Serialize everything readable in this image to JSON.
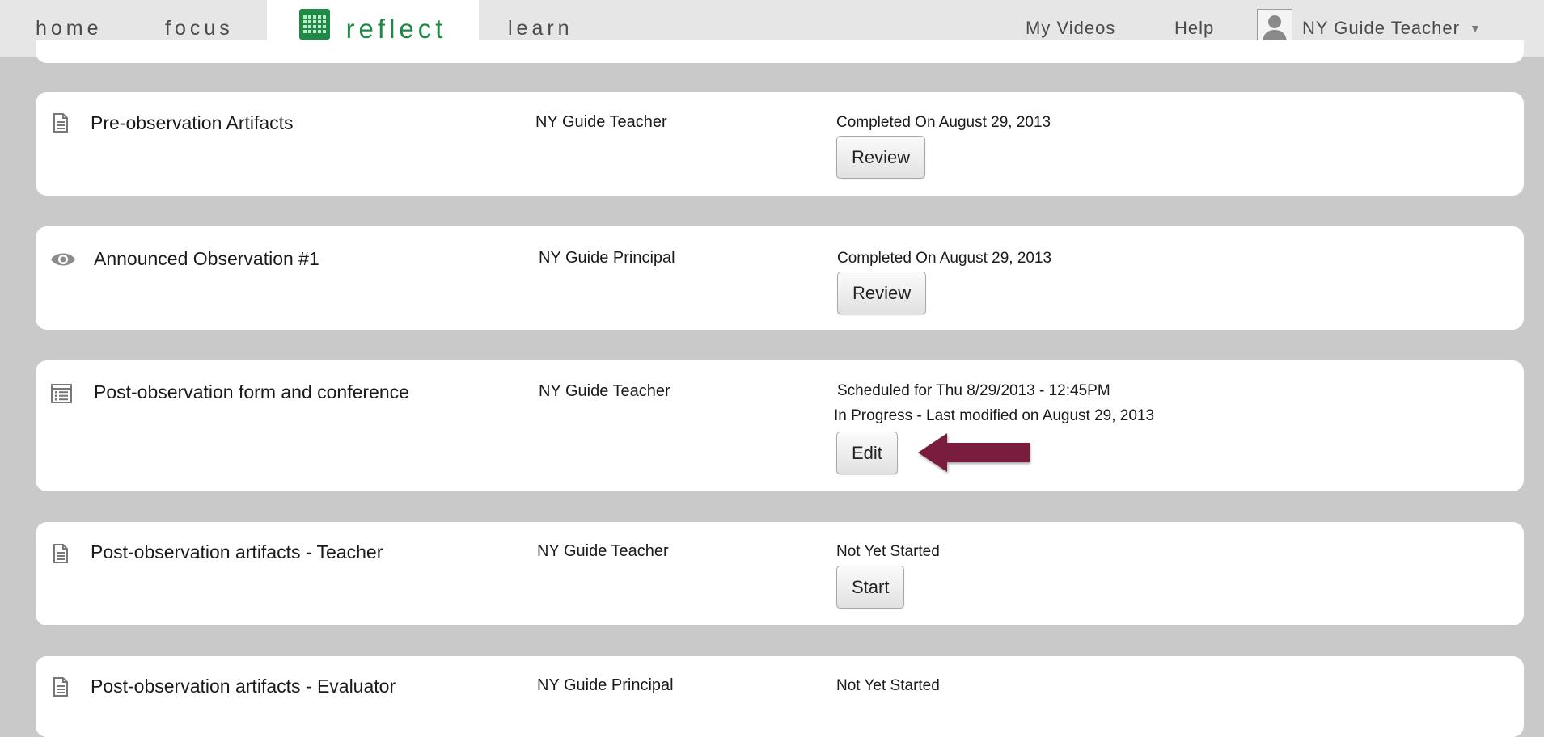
{
  "nav": {
    "home": "home",
    "focus": "focus",
    "reflect": "reflect",
    "learn": "learn",
    "my_videos": "My Videos",
    "help": "Help",
    "user_name": "NY Guide Teacher"
  },
  "colors": {
    "brand_green": "#1e8a45",
    "page_background": "#c9c9c9",
    "arrow": "#7a1f3d"
  },
  "rows": [
    {
      "icon": "document-icon",
      "title": "Pre-observation Artifacts",
      "owner": "NY Guide Teacher",
      "status_lines": [
        "Completed On August 29, 2013"
      ],
      "action": "Review"
    },
    {
      "icon": "eye-icon",
      "title": "Announced Observation #1",
      "owner": "NY Guide Principal",
      "status_lines": [
        "Completed On August 29, 2013"
      ],
      "action": "Review"
    },
    {
      "icon": "form-list-icon",
      "title": "Post-observation form and conference",
      "owner": "NY Guide Teacher",
      "status_lines": [
        "Scheduled for Thu 8/29/2013 - 12:45PM",
        "In Progress - Last modified on August 29, 2013"
      ],
      "action": "Edit"
    },
    {
      "icon": "document-icon",
      "title": "Post-observation artifacts - Teacher",
      "owner": "NY Guide Teacher",
      "status_lines": [
        "Not Yet Started"
      ],
      "action": "Start"
    },
    {
      "icon": "document-icon",
      "title": "Post-observation artifacts - Evaluator",
      "owner": "NY Guide Principal",
      "status_lines": [
        "Not Yet Started"
      ],
      "action": ""
    }
  ]
}
